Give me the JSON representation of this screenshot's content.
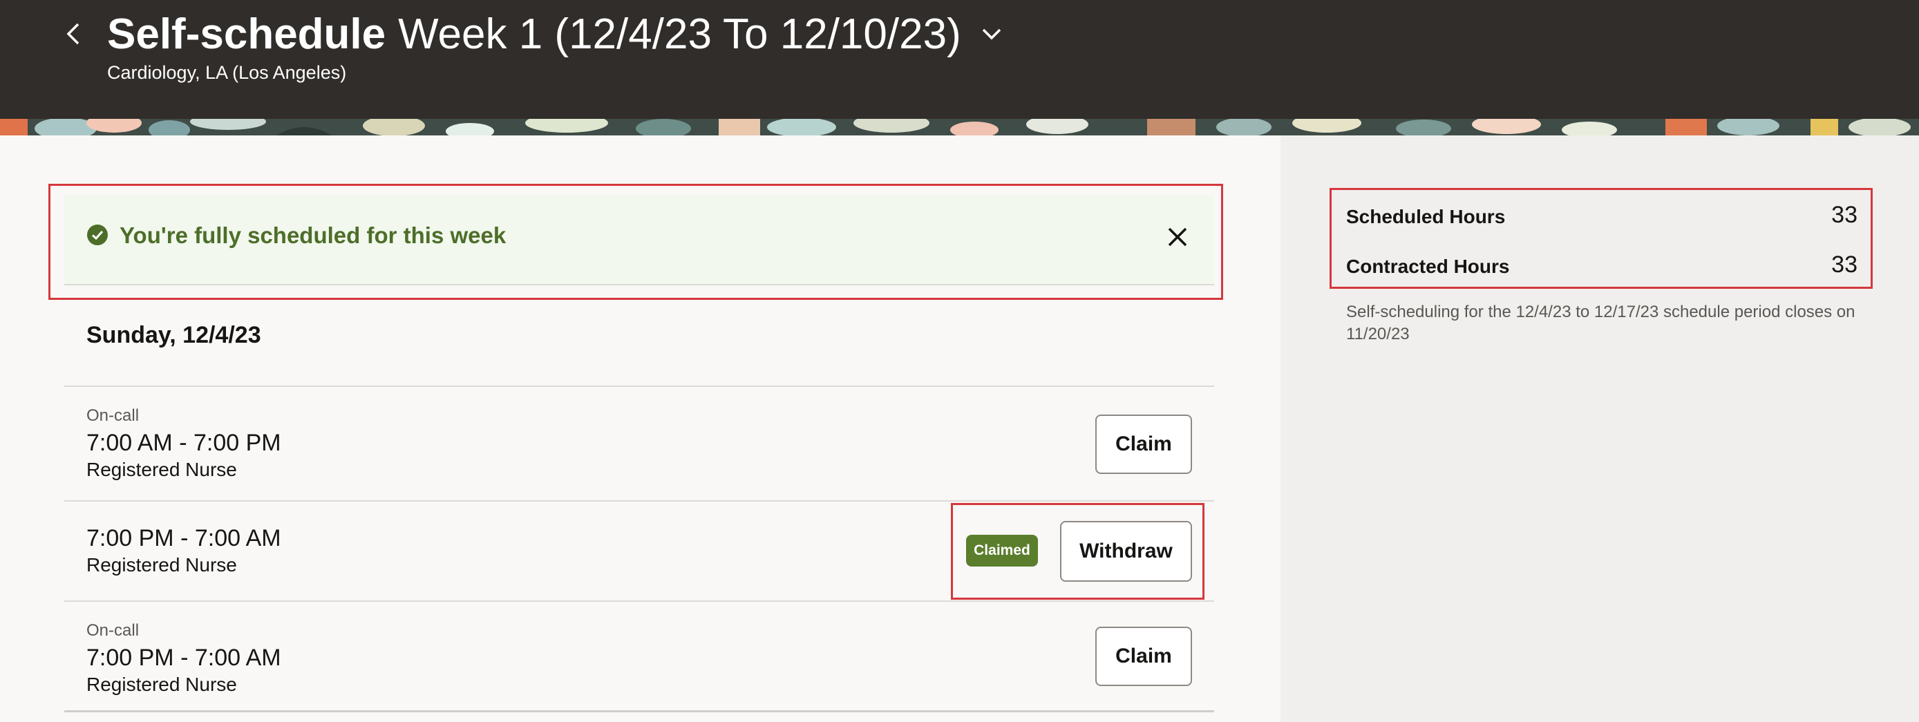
{
  "header": {
    "title_bold": "Self-schedule",
    "title_week": "Week 1 (12/4/23 To 12/10/23)",
    "subtitle": "Cardiology, LA (Los Angeles)"
  },
  "message": {
    "text": "You're fully scheduled for this week",
    "accent": "#4d6e29"
  },
  "day": {
    "heading": "Sunday, 12/4/23"
  },
  "shifts": [
    {
      "type": "On-call",
      "time": "7:00 AM - 7:00 PM",
      "role": "Registered Nurse",
      "action": "Claim"
    },
    {
      "type": "",
      "time": "7:00 PM - 7:00 AM",
      "role": "Registered Nurse",
      "badge": "Claimed",
      "action": "Withdraw"
    },
    {
      "type": "On-call",
      "time": "7:00 PM - 7:00 AM",
      "role": "Registered Nurse",
      "action": "Claim"
    }
  ],
  "summary": {
    "scheduled_label": "Scheduled Hours",
    "scheduled_value": "33",
    "contracted_label": "Contracted Hours",
    "contracted_value": "33",
    "note": "Self-scheduling for the 12/4/23 to 12/17/23 schedule period closes on 11/20/23"
  },
  "colors": {
    "header_bg": "#312d2a",
    "badge_bg": "#5b7e2d",
    "highlight": "#d4383c"
  },
  "icons": [
    "back-chevron-icon",
    "chevron-down-icon",
    "check-circle-icon",
    "close-icon"
  ]
}
